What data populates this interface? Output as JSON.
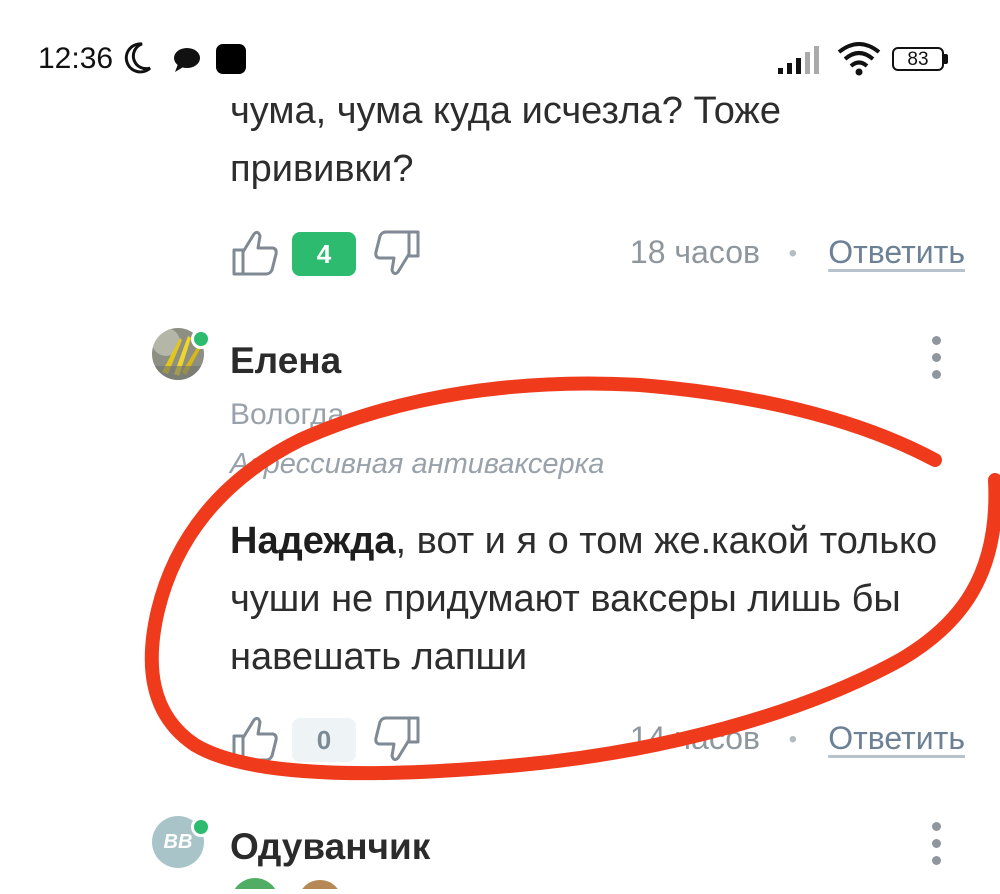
{
  "status_bar": {
    "time": "12:36",
    "battery": "83",
    "icons": [
      "moon-icon",
      "chat-bubble-icon",
      "notification-square-icon",
      "signal-icon",
      "wifi-icon",
      "battery-icon"
    ]
  },
  "previous_comment": {
    "text": "чума, чума куда исчезла? Тоже прививки?",
    "likes": "4",
    "time_ago": "18 часов",
    "separator": "•",
    "reply_label": "Ответить"
  },
  "comment": {
    "author": "Елена",
    "location": "Вологда",
    "status": "Агрессивная антиваксерка",
    "mention": "Надежда",
    "text": ", вот и я о том же.какой только чуши не придумают ваксеры лишь бы навешать лапши",
    "likes": "0",
    "time_ago": "14 часов",
    "separator": "•",
    "reply_label": "Ответить"
  },
  "next_comment": {
    "author": "Одуванчик",
    "avatar_text": "ВВ"
  },
  "colors": {
    "accent_green": "#2dbb6f",
    "link": "#6d8196",
    "muted": "#99a2aa",
    "annotation_red": "#f03a1c"
  }
}
